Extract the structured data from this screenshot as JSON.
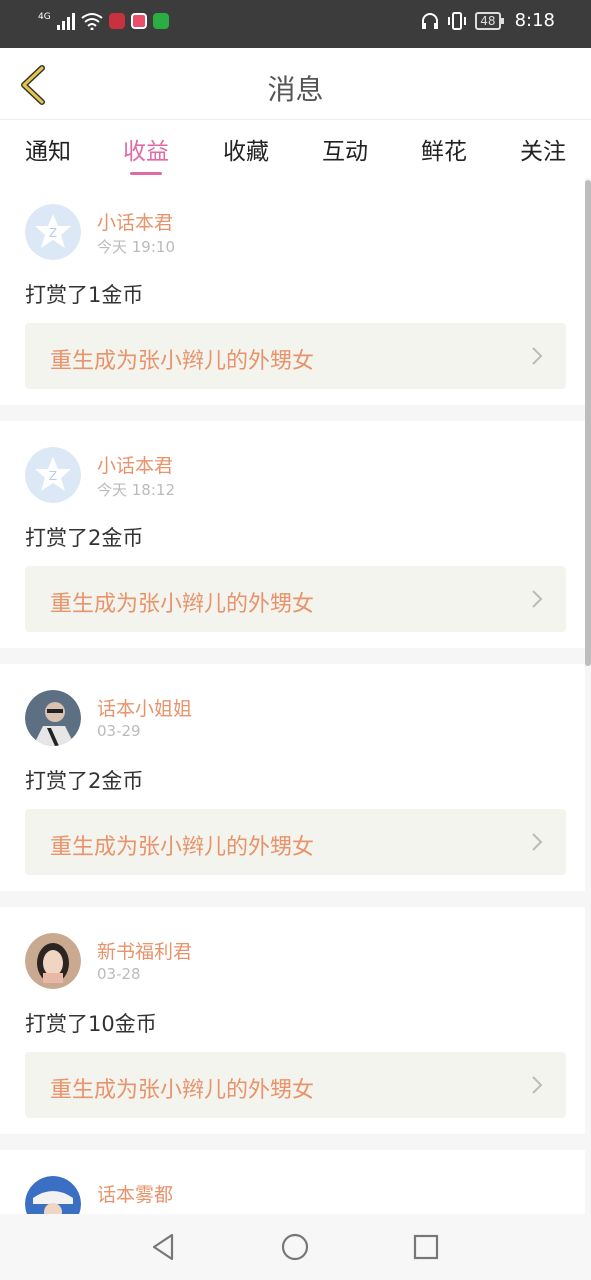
{
  "status_bar": {
    "network": "4G",
    "battery": "48",
    "time": "8:18"
  },
  "header": {
    "title": "消息"
  },
  "tabs": [
    {
      "label": "通知",
      "active": false
    },
    {
      "label": "收益",
      "active": true
    },
    {
      "label": "收藏",
      "active": false
    },
    {
      "label": "互动",
      "active": false
    },
    {
      "label": "鲜花",
      "active": false
    },
    {
      "label": "关注",
      "active": false
    }
  ],
  "messages": [
    {
      "name": "小话本君",
      "time": "今天 19:10",
      "text": "打赏了1金币",
      "book": "重生成为张小辫儿的外甥女",
      "avatar": "default-avatar"
    },
    {
      "name": "小话本君",
      "time": "今天 18:12",
      "text": "打赏了2金币",
      "book": "重生成为张小辫儿的外甥女",
      "avatar": "default-avatar"
    },
    {
      "name": "话本小姐姐",
      "time": "03-29",
      "text": "打赏了2金币",
      "book": "重生成为张小辫儿的外甥女",
      "avatar": "photo-avatar"
    },
    {
      "name": "新书福利君",
      "time": "03-28",
      "text": "打赏了10金币",
      "book": "重生成为张小辫儿的外甥女",
      "avatar": "photo-avatar"
    },
    {
      "name": "话本雾都",
      "avatar": "photo-avatar"
    }
  ],
  "colors": {
    "accent": "#e06aa6",
    "name": "#e8936b",
    "book_bg": "#f4f4ee",
    "status_bar": "#3c3c3c"
  }
}
